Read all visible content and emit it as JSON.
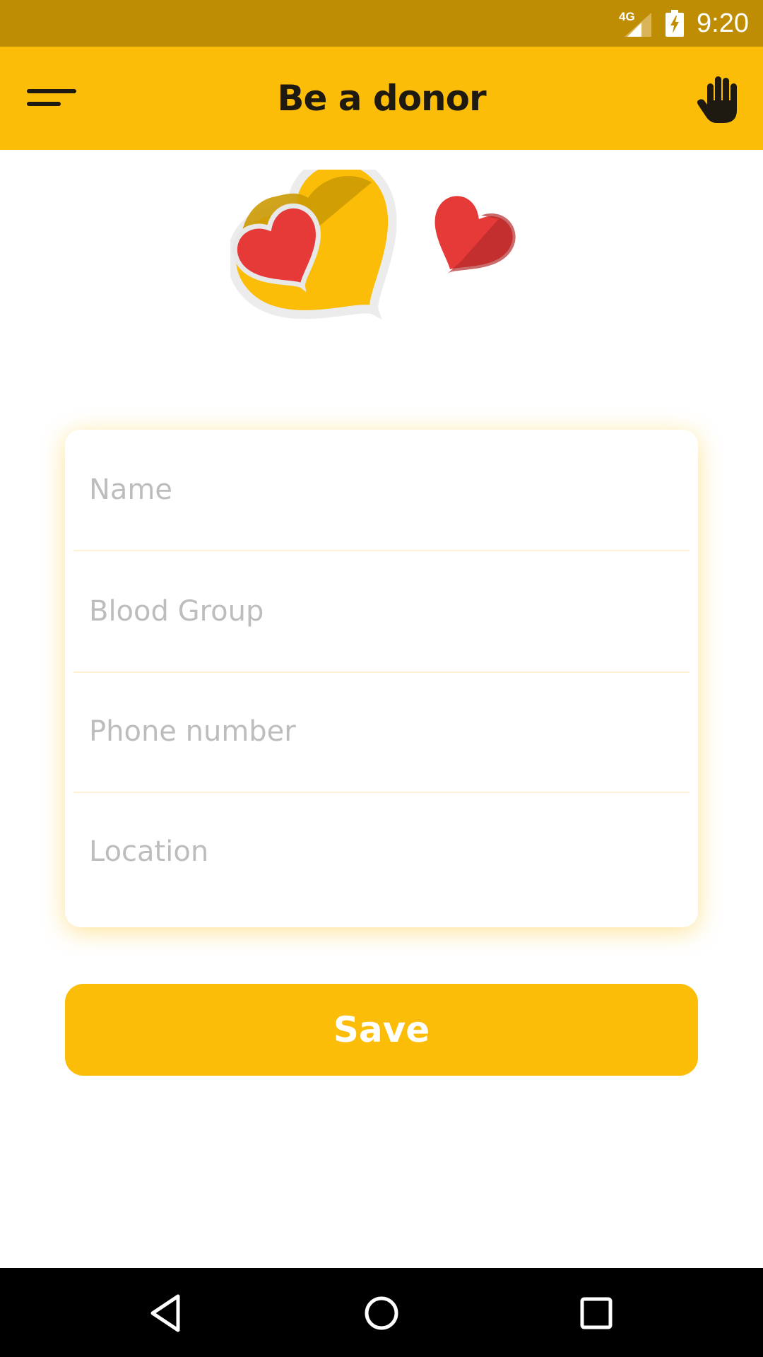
{
  "status_bar": {
    "network": "4G",
    "time": "9:20",
    "icons": [
      "signal-icon",
      "battery-charging-icon"
    ]
  },
  "app_bar": {
    "title": "Be a donor",
    "left_icon": "menu-icon",
    "right_icon": "hand-icon"
  },
  "hero": {
    "icon": "hearts-illustration",
    "colors": {
      "large_heart": "#fbbd07",
      "large_heart_shade": "#cc9a04",
      "small_heart": "#e53a38",
      "small_heart_shade": "#b52b2b"
    }
  },
  "form": {
    "fields": [
      {
        "placeholder": "Name",
        "value": ""
      },
      {
        "placeholder": "Blood Group",
        "value": ""
      },
      {
        "placeholder": "Phone number",
        "value": ""
      },
      {
        "placeholder": "Location",
        "value": ""
      }
    ],
    "save_label": "Save"
  },
  "nav_bar": {
    "icons": [
      "back-icon",
      "home-icon",
      "recents-icon"
    ]
  },
  "colors": {
    "status_bar": "#bf8d03",
    "accent": "#fbbd07",
    "title_text": "#1e1a12",
    "placeholder": "#bdbdbd"
  }
}
